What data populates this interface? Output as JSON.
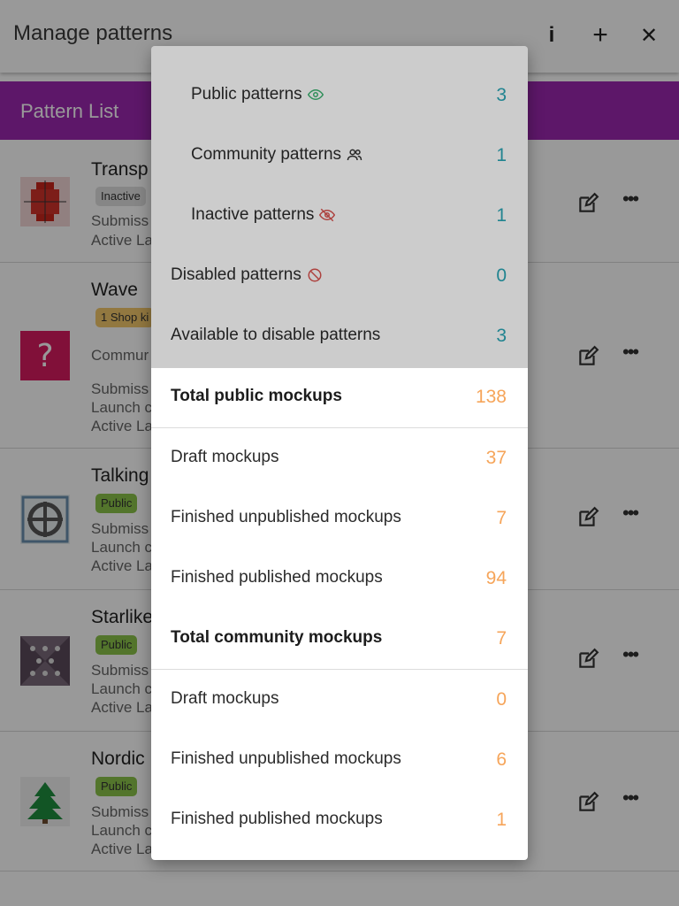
{
  "app_bar": {
    "title": "Manage patterns",
    "info_icon": "i",
    "add_icon": "+",
    "close_icon": "✕"
  },
  "section_header": {
    "label": "Pattern List"
  },
  "patterns": [
    {
      "name": "Transp",
      "chip": "Inactive",
      "lines": [
        "Submiss",
        "Active La"
      ]
    },
    {
      "name": "Wave",
      "chip": "1 Shop ki",
      "lines": [
        "Commur",
        "Submiss",
        "Launch c",
        "Active La"
      ]
    },
    {
      "name": "Talking",
      "chip": "Public",
      "lines": [
        "Submiss",
        "Launch c",
        "Active La"
      ]
    },
    {
      "name": "Starlike",
      "chip": "Public",
      "lines": [
        "Submiss",
        "Launch c",
        "Active La"
      ]
    },
    {
      "name": "Nordic",
      "chip": "Public",
      "lines": [
        "Submiss",
        "Launch c",
        "Active La"
      ]
    }
  ],
  "popup": {
    "pattern_stats": [
      {
        "label": "Public patterns",
        "value": "3",
        "icon": "eye-icon",
        "indent": true
      },
      {
        "label": "Community patterns",
        "value": "1",
        "icon": "people-icon",
        "indent": true
      },
      {
        "label": "Inactive patterns",
        "value": "1",
        "icon": "eye-off-icon",
        "indent": true
      },
      {
        "label": "Disabled patterns",
        "value": "0",
        "icon": "block-icon",
        "indent": false
      },
      {
        "label": "Available to disable patterns",
        "value": "3",
        "icon": "",
        "indent": false
      }
    ],
    "mockup_stats": [
      {
        "label": "Total public mockups",
        "value": "138",
        "bold": true
      },
      {
        "label": "Draft mockups",
        "value": "37",
        "bold": false
      },
      {
        "label": "Finished unpublished mockups",
        "value": "7",
        "bold": false
      },
      {
        "label": "Finished published mockups",
        "value": "94",
        "bold": false
      },
      {
        "label": "Total community mockups",
        "value": "7",
        "bold": true
      },
      {
        "label": "Draft mockups",
        "value": "0",
        "bold": false
      },
      {
        "label": "Finished unpublished mockups",
        "value": "6",
        "bold": false
      },
      {
        "label": "Finished published mockups",
        "value": "1",
        "bold": false
      }
    ]
  },
  "colors": {
    "accent_purple": "#9c27b0",
    "teal_value": "#2aa5b5",
    "orange_value": "#f6a55a",
    "eye_green": "#3cb371",
    "eye_off_red": "#d9534f",
    "chip_public": "#8bc34a",
    "chip_inactive": "#e0e0e0",
    "chip_shop": "#f3c96b"
  }
}
